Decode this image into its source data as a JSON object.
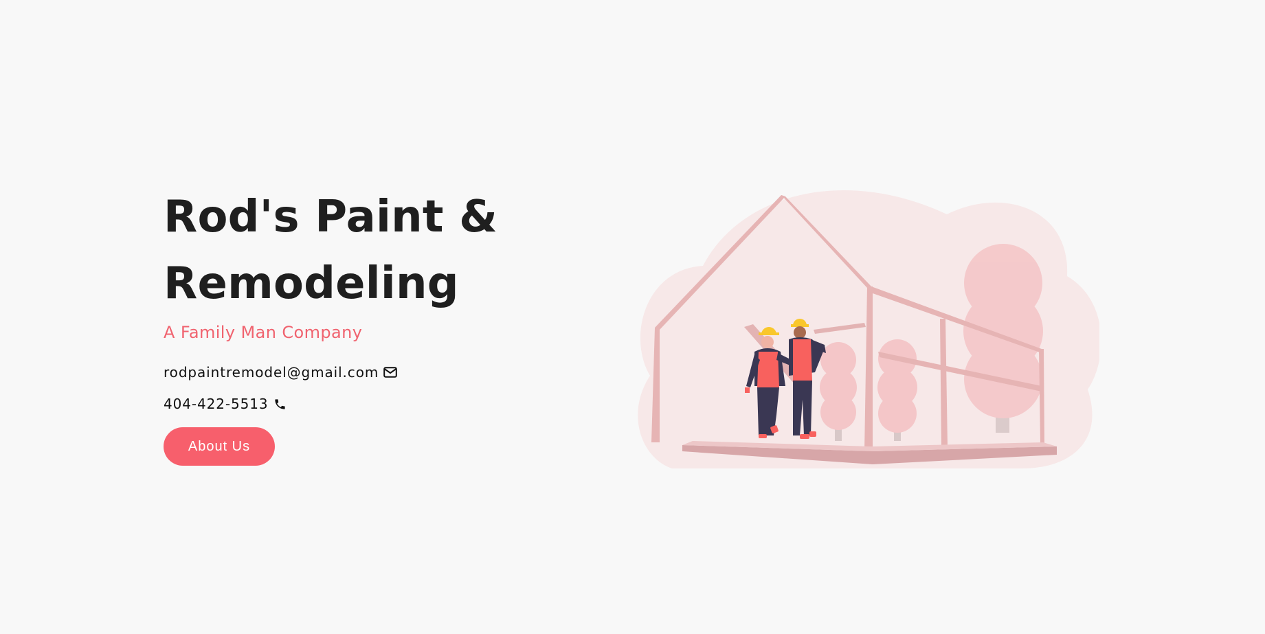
{
  "hero": {
    "title_line1": "Rod's Paint &",
    "title_line2": "Remodeling",
    "tagline": "A Family Man Company",
    "email": "rodpaintremodel@gmail.com",
    "email_icon": "envelope-icon",
    "phone": "404-422-5513",
    "phone_icon": "phone-icon",
    "cta_label": "About Us"
  },
  "illustration": {
    "subject": "construction-workers-house-frame",
    "colors": {
      "blob": "#f7e8e8",
      "frame": "#e6b4b4",
      "tree": "#f4c6c8",
      "vest": "#f8615e",
      "pants": "#3a3753",
      "helmet": "#f9c72c"
    }
  },
  "colors": {
    "background": "#f8f8f8",
    "accent": "#f75f6c",
    "text": "#1f1f1f"
  }
}
